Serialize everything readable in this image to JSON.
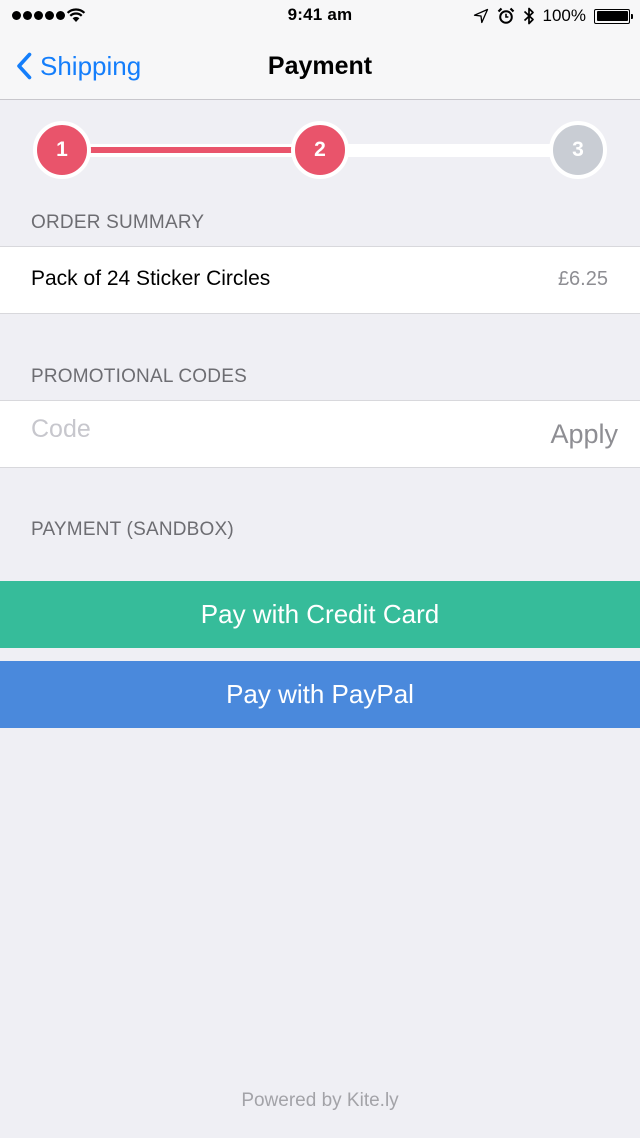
{
  "status_bar": {
    "time": "9:41 am",
    "battery": "100%",
    "icons": [
      "signal-dots-icon",
      "wifi-icon",
      "location-arrow-icon",
      "alarm-icon",
      "bluetooth-icon",
      "battery-icon"
    ]
  },
  "nav": {
    "back_label": "Shipping",
    "title": "Payment"
  },
  "stepper": {
    "steps": [
      "1",
      "2",
      "3"
    ],
    "current": 2,
    "done_color": "#e9546b",
    "todo_color": "#c9cdd4"
  },
  "order_summary": {
    "header": "ORDER SUMMARY",
    "item": "Pack of 24 Sticker Circles",
    "price": "£6.25"
  },
  "promo": {
    "header": "PROMOTIONAL CODES",
    "placeholder": "Code",
    "value": "",
    "apply_label": "Apply"
  },
  "payment": {
    "header": "PAYMENT (SANDBOX)",
    "credit_card_label": "Pay with Credit Card",
    "credit_card_color": "#36bc9a",
    "paypal_label": "Pay with PayPal",
    "paypal_color": "#4a89dc"
  },
  "footer": "Powered by Kite.ly",
  "colors": {
    "accent": "#147efb",
    "background": "#efeff4"
  }
}
